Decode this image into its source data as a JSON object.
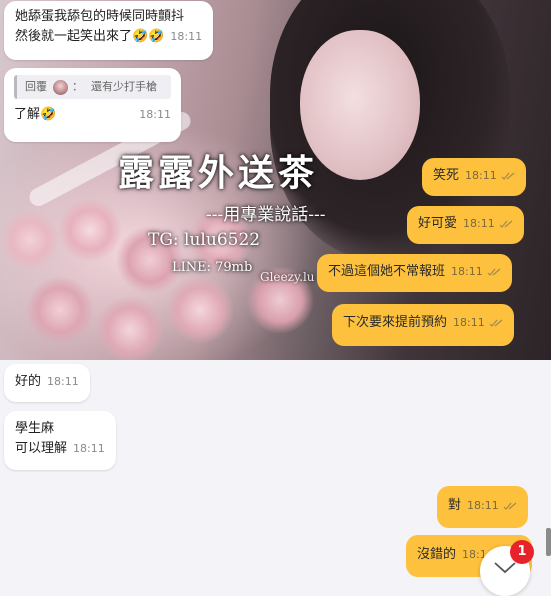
{
  "photo_watermark": {
    "title": "露露外送茶",
    "subtitle": "---用專業說話---",
    "tg": "TG: lulu6522",
    "line": "LINE: 79mb",
    "mark": "Gleezy.lu"
  },
  "messages": [
    {
      "side": "in",
      "lines": [
        "她舔蛋我舔包的時候同時顫抖",
        "然後就一起笑出來了🤣🤣"
      ],
      "time": "18:11"
    },
    {
      "side": "in",
      "reply": {
        "label": "回覆",
        "separator": "：",
        "quote": "還有少打手槍"
      },
      "text": "了解🤣",
      "time": "18:11"
    },
    {
      "side": "out",
      "text": "笑死",
      "time": "18:11"
    },
    {
      "side": "out",
      "text": "好可愛",
      "time": "18:11"
    },
    {
      "side": "out",
      "text": "不過這個她不常報班",
      "time": "18:11"
    },
    {
      "side": "out",
      "text": "下次要來提前預約",
      "time": "18:11"
    },
    {
      "side": "in",
      "text": "好的",
      "time": "18:11"
    },
    {
      "side": "in",
      "lines": [
        "學生麻",
        "可以理解"
      ],
      "time": "18:11"
    },
    {
      "side": "out",
      "text": "對",
      "time": "18:11"
    },
    {
      "side": "out",
      "text": "沒錯的",
      "time": "18:1"
    }
  ],
  "scroll_fab": {
    "icon": "chevron-down-icon",
    "unread_count": "1"
  },
  "colors": {
    "outgoing": "#fdc13e",
    "incoming": "#ffffff",
    "badge": "#e8222a",
    "background": "#f4f3f7"
  }
}
